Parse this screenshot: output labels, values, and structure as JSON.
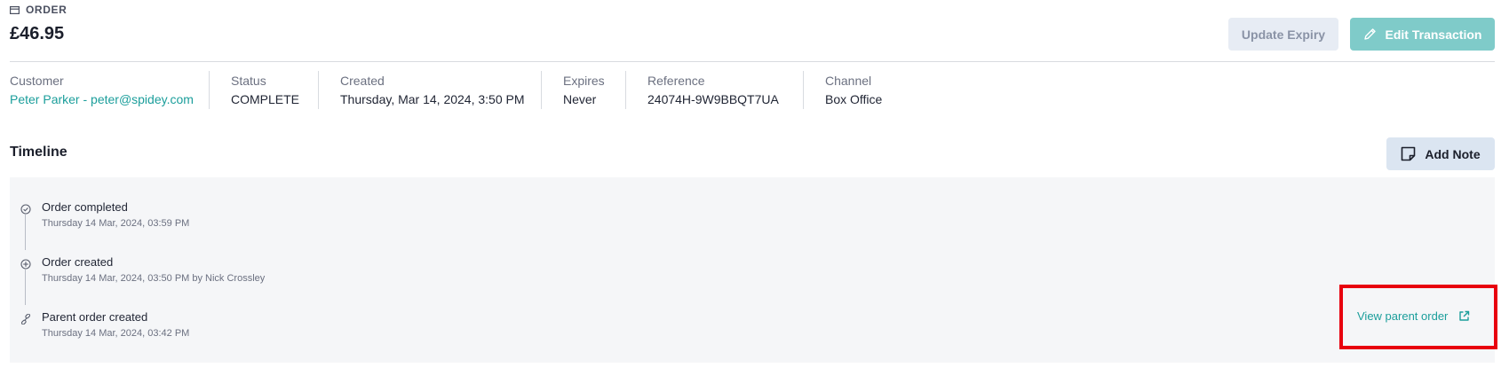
{
  "header": {
    "section_label": "ORDER",
    "amount": "£46.95",
    "update_expiry_label": "Update Expiry",
    "edit_transaction_label": "Edit Transaction"
  },
  "meta": {
    "customer": {
      "label": "Customer",
      "value": "Peter Parker - peter@spidey.com"
    },
    "status": {
      "label": "Status",
      "value": "COMPLETE"
    },
    "created": {
      "label": "Created",
      "value": "Thursday, Mar 14, 2024, 3:50 PM"
    },
    "expires": {
      "label": "Expires",
      "value": "Never"
    },
    "reference": {
      "label": "Reference",
      "value": "24074H-9W9BBQT7UA"
    },
    "channel": {
      "label": "Channel",
      "value": "Box Office"
    }
  },
  "timeline": {
    "title": "Timeline",
    "add_note_label": "Add Note",
    "items": [
      {
        "icon": "check-circle-icon",
        "title": "Order completed",
        "subtitle": "Thursday 14 Mar, 2024, 03:59 PM"
      },
      {
        "icon": "plus-circle-icon",
        "title": "Order created",
        "subtitle": "Thursday 14 Mar, 2024, 03:50 PM by Nick Crossley"
      },
      {
        "icon": "link-icon",
        "title": "Parent order created",
        "subtitle": "Thursday 14 Mar, 2024, 03:42 PM"
      }
    ],
    "view_parent_label": "View parent order"
  },
  "colors": {
    "accent": "#1b9e9b",
    "edit_button": "#7fcbc9",
    "highlight": "#e8000e"
  }
}
